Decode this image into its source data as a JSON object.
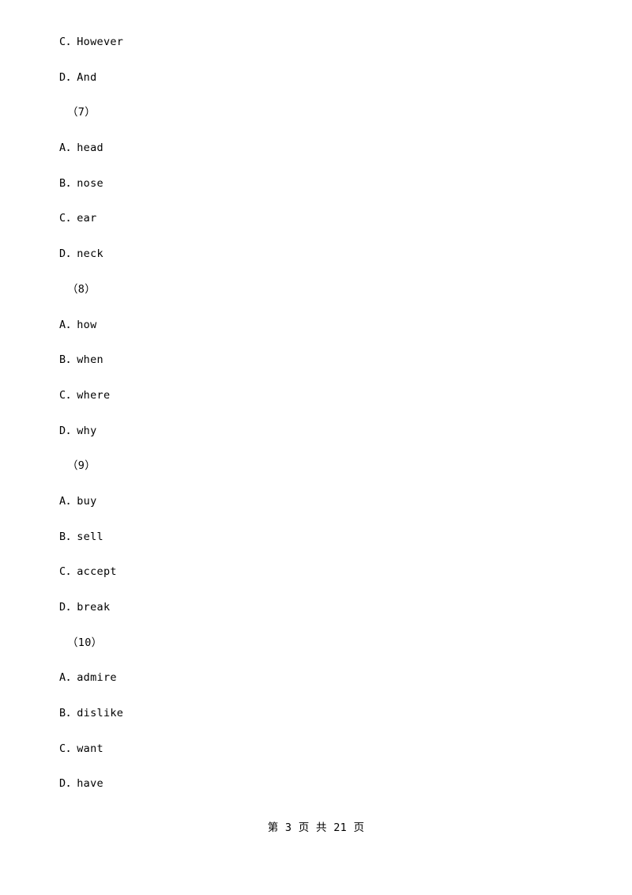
{
  "document": {
    "lines": [
      {
        "text": "C．However",
        "type": "option"
      },
      {
        "text": "D．And",
        "type": "option"
      },
      {
        "text": "（7）",
        "type": "group"
      },
      {
        "text": "A．head",
        "type": "option"
      },
      {
        "text": "B．nose",
        "type": "option"
      },
      {
        "text": "C．ear",
        "type": "option"
      },
      {
        "text": "D．neck",
        "type": "option"
      },
      {
        "text": "（8）",
        "type": "group"
      },
      {
        "text": "A．how",
        "type": "option"
      },
      {
        "text": "B．when",
        "type": "option"
      },
      {
        "text": "C．where",
        "type": "option"
      },
      {
        "text": "D．why",
        "type": "option"
      },
      {
        "text": "（9）",
        "type": "group"
      },
      {
        "text": "A．buy",
        "type": "option"
      },
      {
        "text": "B．sell",
        "type": "option"
      },
      {
        "text": "C．accept",
        "type": "option"
      },
      {
        "text": "D．break",
        "type": "option"
      },
      {
        "text": "（10）",
        "type": "group"
      },
      {
        "text": "A．admire",
        "type": "option"
      },
      {
        "text": "B．dislike",
        "type": "option"
      },
      {
        "text": "C．want",
        "type": "option"
      },
      {
        "text": "D．have",
        "type": "option"
      }
    ],
    "footer": "第 3 页 共 21 页"
  }
}
